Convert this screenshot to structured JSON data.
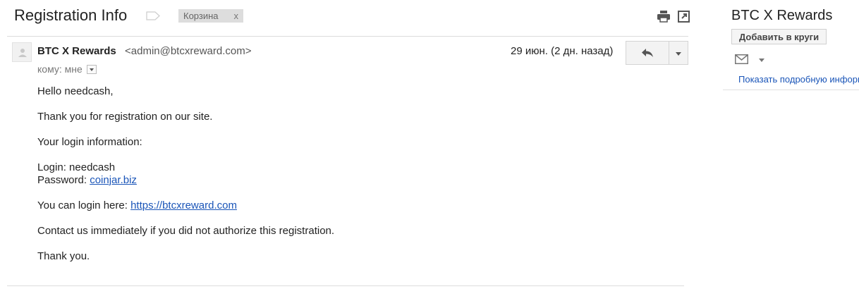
{
  "header": {
    "subject": "Registration Info",
    "label": "Корзина",
    "label_remove": "x"
  },
  "message": {
    "sender_name": "BTC X Rewards",
    "sender_email": "<admin@btcxreward.com>",
    "recipient": "кому: мне",
    "date": "29 июн. (2 дн. назад)",
    "body": {
      "greeting": "Hello needcash,",
      "line1": "Thank you for registration on our site.",
      "line2": "Your login information:",
      "login": "Login: needcash",
      "password_label": "Password: ",
      "password_link": "coinjar.biz",
      "login_here": "You can login here: ",
      "login_link": "https://btcxreward.com",
      "contact": "Contact us immediately if you did not authorize this registration.",
      "thanks": "Thank you."
    }
  },
  "sidebar": {
    "name": "BTC X Rewards",
    "add_to_circles": "Добавить в круги",
    "details_link": "Показать подробную информацию"
  },
  "icons": {
    "important": "important-marker-icon",
    "print": "print-icon",
    "new_window": "open-in-new-window-icon",
    "reply": "reply-icon",
    "mail": "mail-icon"
  }
}
